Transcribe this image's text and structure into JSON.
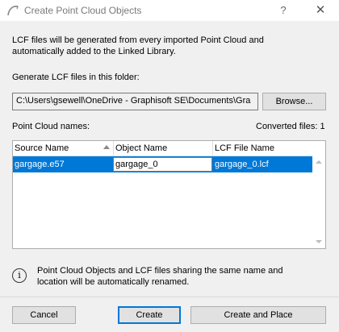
{
  "window": {
    "title": "Create Point Cloud Objects",
    "help_glyph": "?",
    "close_glyph": "✕",
    "app_icon": "archicad-icon"
  },
  "intro": {
    "line1": "LCF files will be generated from every imported Point Cloud and",
    "line2": "automatically added to the Linked Library."
  },
  "folder": {
    "label": "Generate LCF files in this folder:",
    "path": "C:\\Users\\gsewell\\OneDrive - Graphisoft SE\\Documents\\Gra",
    "browse_label": "Browse..."
  },
  "names": {
    "label": "Point Cloud names:",
    "converted": "Converted files: 1"
  },
  "table": {
    "columns": [
      "Source Name",
      "Object Name",
      "LCF File Name"
    ],
    "rows": [
      {
        "source": "gargage.e57",
        "object": "gargage_0",
        "lcf": "gargage_0.lcf",
        "selected": true
      }
    ]
  },
  "info": {
    "icon": "info-icon",
    "line1": "Point Cloud Objects and LCF files sharing the same name and",
    "line2": "location will be automatically renamed."
  },
  "buttons": {
    "cancel": "Cancel",
    "create": "Create",
    "create_place": "Create and Place"
  },
  "colors": {
    "selection": "#0078d7",
    "background": "#f0f0f0"
  }
}
